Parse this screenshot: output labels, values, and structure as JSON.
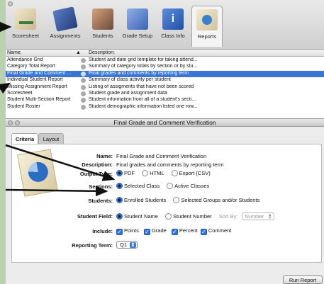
{
  "toolbar": {
    "items": [
      {
        "label": "Scoresheet",
        "icon": "scoresheet-icon"
      },
      {
        "label": "Assignments",
        "icon": "assignments-icon"
      },
      {
        "label": "Students",
        "icon": "students-icon"
      },
      {
        "label": "Grade Setup",
        "icon": "grade-setup-icon"
      },
      {
        "label": "Class Info",
        "icon": "class-info-icon"
      },
      {
        "label": "Reports",
        "icon": "reports-icon",
        "active": true
      }
    ]
  },
  "reports_list": {
    "headers": {
      "name": "Name:",
      "sort_indicator": "▲",
      "description": "Description:"
    },
    "rows": [
      {
        "name": "Attendance Grid",
        "description": "Student and date grid template for taking attend..."
      },
      {
        "name": "Category Total Report",
        "description": "Summary of category totals by section or by stu..."
      },
      {
        "name": "Final Grade and Comment ...",
        "description": "Final grades and comments by reporting term",
        "selected": true
      },
      {
        "name": "Individual Student Report",
        "description": "Summary of class activity per student"
      },
      {
        "name": "Missing Assignment Report",
        "description": "Listing of assigments that have not been scored"
      },
      {
        "name": "Scoresheet",
        "description": "Student grade and assignment data"
      },
      {
        "name": "Student Multi-Section Report",
        "description": "Student information from all of a student's secti..."
      },
      {
        "name": "Student Roster",
        "description": "Student demographic information listed one row..."
      }
    ]
  },
  "dialog": {
    "title": "Final Grade and Comment Verification",
    "tabs": [
      "Criteria",
      "Layout"
    ],
    "fields": {
      "name_label": "Name:",
      "name_value": "Final Grade and Comment Verification",
      "description_label": "Description:",
      "description_value": "Final grades and comments by reporting term",
      "output_label": "Output Type:",
      "output_options": [
        "PDF",
        "HTML",
        "Export (CSV)"
      ],
      "sections_label": "Sections:",
      "sections_options": [
        "Selected Class",
        "Active Classes"
      ],
      "students_label": "Students:",
      "students_options": [
        "Enrolled Students",
        "Selected Groups and/or Students"
      ],
      "student_field_label": "Student Field:",
      "student_field_options": [
        "Student Name",
        "Student Number"
      ],
      "sort_by_label": "Sort By:",
      "sort_by_value": "Number",
      "include_label": "Include:",
      "include_options": [
        "Points",
        "Grade",
        "Percent",
        "Comment"
      ],
      "reporting_term_label": "Reporting Term:",
      "reporting_term_value": "Q1"
    },
    "run_button": "Run Report"
  },
  "colors": {
    "selection": "#3875d7",
    "background": "#b9d1b0",
    "arrow": "#111111"
  }
}
